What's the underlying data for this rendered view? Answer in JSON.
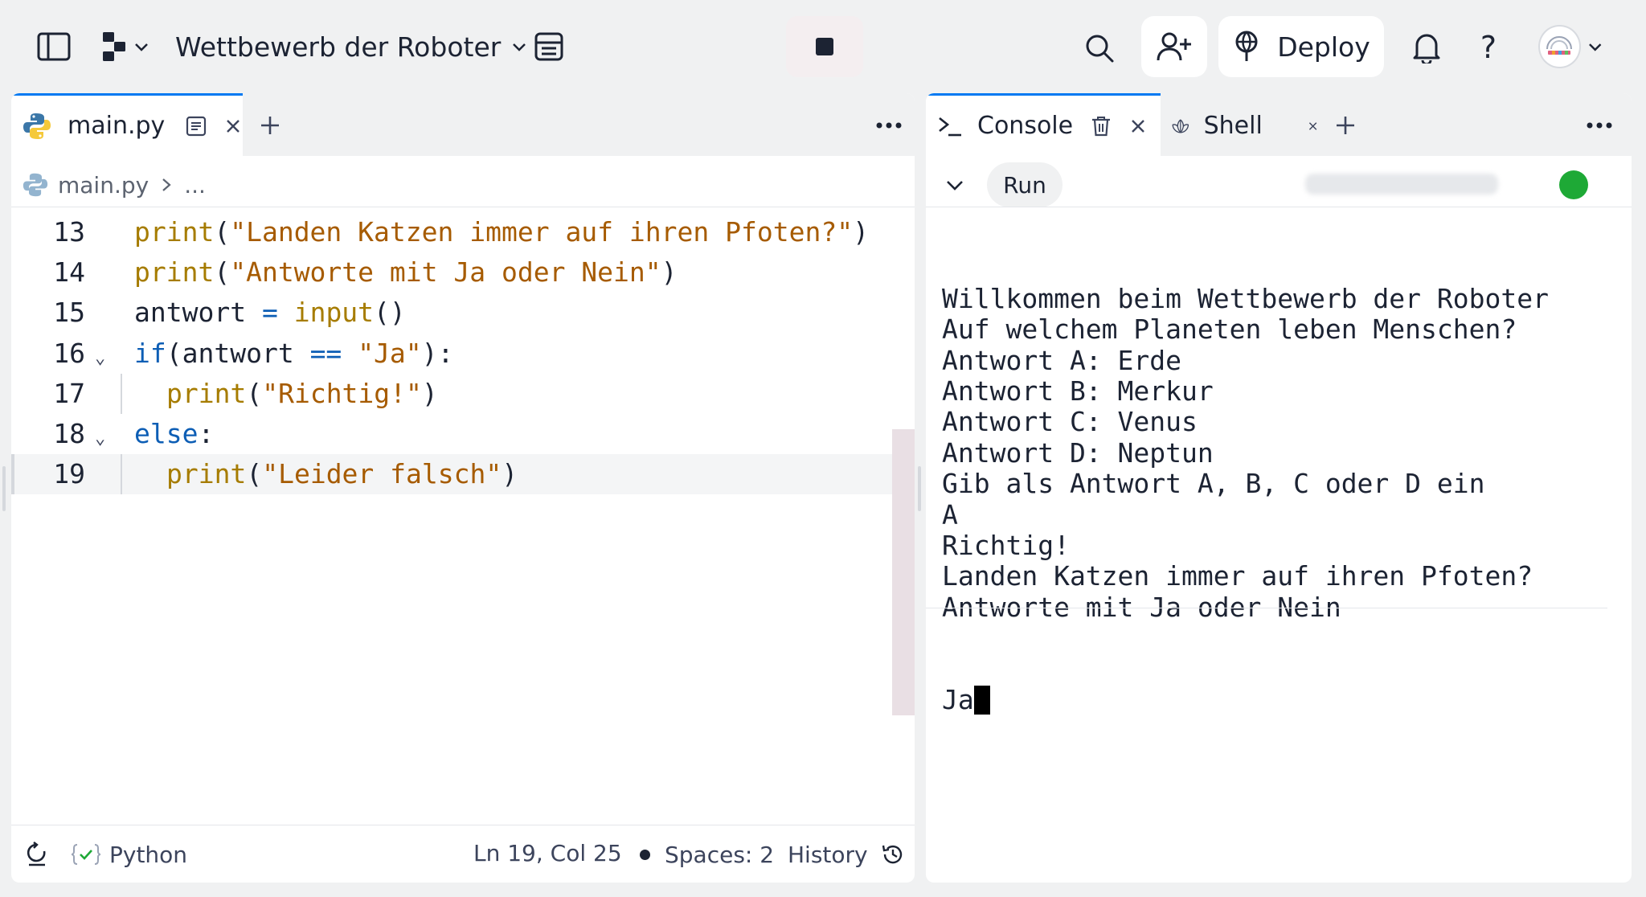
{
  "topbar": {
    "project_title": "Wettbewerb der Roboter",
    "deploy_label": "Deploy",
    "help_label": "?"
  },
  "editor": {
    "tab_label": "main.py",
    "breadcrumb_file": "main.py",
    "breadcrumb_more": "...",
    "lines": [
      {
        "n": "13",
        "segments": [
          [
            "fn",
            "print"
          ],
          [
            "p",
            "("
          ],
          [
            "str",
            "\"Landen Katzen immer auf ihren Pfoten?\""
          ],
          [
            "p",
            ")"
          ]
        ],
        "indent": 0,
        "fold": false
      },
      {
        "n": "14",
        "segments": [
          [
            "fn",
            "print"
          ],
          [
            "p",
            "("
          ],
          [
            "str",
            "\"Antworte mit Ja oder Nein\""
          ],
          [
            "p",
            ")"
          ]
        ],
        "indent": 0,
        "fold": false
      },
      {
        "n": "15",
        "segments": [
          [
            "p",
            "antwort "
          ],
          [
            "op",
            "="
          ],
          [
            "p",
            " "
          ],
          [
            "fn",
            "input"
          ],
          [
            "p",
            "()"
          ]
        ],
        "indent": 0,
        "fold": false
      },
      {
        "n": "16",
        "segments": [
          [
            "kw",
            "if"
          ],
          [
            "p",
            "(antwort "
          ],
          [
            "op",
            "=="
          ],
          [
            "p",
            " "
          ],
          [
            "str",
            "\"Ja\""
          ],
          [
            "p",
            "):"
          ]
        ],
        "indent": 0,
        "fold": true
      },
      {
        "n": "17",
        "segments": [
          [
            "fn",
            "print"
          ],
          [
            "p",
            "("
          ],
          [
            "str",
            "\"Richtig!\""
          ],
          [
            "p",
            ")"
          ]
        ],
        "indent": 1,
        "fold": false
      },
      {
        "n": "18",
        "segments": [
          [
            "kw",
            "else"
          ],
          [
            "p",
            ":"
          ]
        ],
        "indent": 0,
        "fold": true
      },
      {
        "n": "19",
        "segments": [
          [
            "fn",
            "print"
          ],
          [
            "p",
            "("
          ],
          [
            "str",
            "\"Leider falsch\""
          ],
          [
            "p",
            ")"
          ]
        ],
        "indent": 1,
        "fold": false
      }
    ]
  },
  "statusbar": {
    "language": "Python",
    "position": "Ln 19, Col 25",
    "spaces": "Spaces: 2",
    "history": "History"
  },
  "console": {
    "tab_console": "Console",
    "tab_shell": "Shell",
    "run_label": "Run",
    "output_lines": [
      "Willkommen beim Wettbewerb der Roboter",
      "Auf welchem Planeten leben Menschen?",
      "Antwort A: Erde",
      "Antwort B: Merkur",
      "Antwort C: Venus",
      "Antwort D: Neptun",
      "Gib als Antwort A, B, C oder D ein",
      "A",
      "Richtig!",
      "Landen Katzen immer auf ihren Pfoten?",
      "Antworte mit Ja oder Nein"
    ],
    "input_text": "Ja"
  },
  "colors": {
    "accent": "#0079f2",
    "status_ok": "#1ea936"
  }
}
